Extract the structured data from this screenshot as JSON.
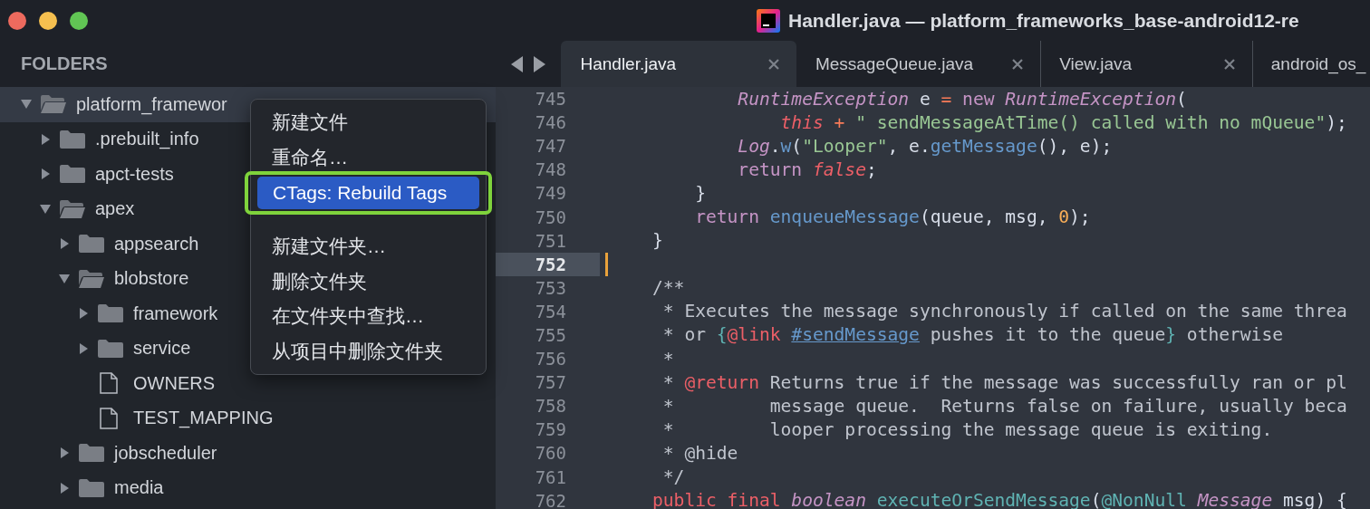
{
  "window": {
    "title": "Handler.java — platform_frameworks_base-android12-re"
  },
  "sidebar": {
    "heading": "FOLDERS",
    "tree": [
      {
        "label": "platform_framewor",
        "kind": "folder",
        "expanded": true,
        "selected": true,
        "children": [
          {
            "label": ".prebuilt_info",
            "kind": "folder",
            "expanded": false,
            "selected": false
          },
          {
            "label": "apct-tests",
            "kind": "folder",
            "expanded": false,
            "selected": false
          },
          {
            "label": "apex",
            "kind": "folder",
            "expanded": true,
            "selected": false,
            "children": [
              {
                "label": "appsearch",
                "kind": "folder",
                "expanded": false,
                "selected": false
              },
              {
                "label": "blobstore",
                "kind": "folder",
                "expanded": true,
                "selected": false,
                "children": [
                  {
                    "label": "framework",
                    "kind": "folder",
                    "expanded": false,
                    "selected": false
                  },
                  {
                    "label": "service",
                    "kind": "folder",
                    "expanded": false,
                    "selected": false
                  },
                  {
                    "label": "OWNERS",
                    "kind": "file",
                    "selected": false
                  },
                  {
                    "label": "TEST_MAPPING",
                    "kind": "file",
                    "selected": false
                  }
                ]
              },
              {
                "label": "jobscheduler",
                "kind": "folder",
                "expanded": false,
                "selected": false
              },
              {
                "label": "media",
                "kind": "folder",
                "expanded": false,
                "selected": false
              }
            ]
          }
        ]
      }
    ]
  },
  "context_menu": {
    "items": [
      {
        "kind": "item",
        "label": "新建文件",
        "selected": false,
        "outlined": false
      },
      {
        "kind": "item",
        "label": "重命名…",
        "selected": false,
        "outlined": false
      },
      {
        "kind": "item",
        "label": "CTags: Rebuild Tags",
        "selected": true,
        "outlined": true
      },
      {
        "kind": "separator"
      },
      {
        "kind": "item",
        "label": "新建文件夹…",
        "selected": false,
        "outlined": false
      },
      {
        "kind": "item",
        "label": "删除文件夹",
        "selected": false,
        "outlined": false
      },
      {
        "kind": "item",
        "label": "在文件夹中查找…",
        "selected": false,
        "outlined": false
      },
      {
        "kind": "item",
        "label": "从项目中删除文件夹",
        "selected": false,
        "outlined": false
      }
    ]
  },
  "tabs": [
    {
      "label": "Handler.java",
      "selected": true,
      "closable": true
    },
    {
      "label": "MessageQueue.java",
      "selected": false,
      "closable": true
    },
    {
      "label": "View.java",
      "selected": false,
      "closable": true
    },
    {
      "label": "android_os_",
      "selected": false,
      "closable": false
    }
  ],
  "editor": {
    "lines": [
      {
        "number": "745",
        "current": false,
        "tokens": [
          {
            "kind": "type",
            "t": "        RuntimeException"
          },
          {
            "kind": "plain",
            "t": " e "
          },
          {
            "kind": "op",
            "t": "= "
          },
          {
            "kind": "kw",
            "t": "new "
          },
          {
            "kind": "type",
            "t": "RuntimeException"
          },
          {
            "kind": "plain",
            "t": "("
          }
        ]
      },
      {
        "number": "746",
        "current": false,
        "tokens": [
          {
            "kind": "lit",
            "t": "            this "
          },
          {
            "kind": "op",
            "t": "+ "
          },
          {
            "kind": "str",
            "t": "\" sendMessageAtTime() called with no mQueue\""
          },
          {
            "kind": "plain",
            "t": ");"
          }
        ]
      },
      {
        "number": "747",
        "current": false,
        "tokens": [
          {
            "kind": "type",
            "t": "        Log"
          },
          {
            "kind": "plain",
            "t": "."
          },
          {
            "kind": "fn",
            "t": "w"
          },
          {
            "kind": "plain",
            "t": "("
          },
          {
            "kind": "str",
            "t": "\"Looper\""
          },
          {
            "kind": "plain",
            "t": ", e."
          },
          {
            "kind": "fn",
            "t": "getMessage"
          },
          {
            "kind": "plain",
            "t": "(), e);"
          }
        ]
      },
      {
        "number": "748",
        "current": false,
        "tokens": [
          {
            "kind": "kw",
            "t": "        return "
          },
          {
            "kind": "lit",
            "t": "false"
          },
          {
            "kind": "plain",
            "t": ";"
          }
        ]
      },
      {
        "number": "749",
        "current": false,
        "tokens": [
          {
            "kind": "plain",
            "t": "    }"
          }
        ]
      },
      {
        "number": "750",
        "current": false,
        "tokens": [
          {
            "kind": "kw",
            "t": "    return "
          },
          {
            "kind": "fn",
            "t": "enqueueMessage"
          },
          {
            "kind": "plain",
            "t": "(queue, msg, "
          },
          {
            "kind": "num",
            "t": "0"
          },
          {
            "kind": "plain",
            "t": ");"
          }
        ]
      },
      {
        "number": "751",
        "current": false,
        "tokens": [
          {
            "kind": "plain",
            "t": "}"
          }
        ]
      },
      {
        "number": "752",
        "current": true
      },
      {
        "number": "753",
        "current": false,
        "tokens": [
          {
            "kind": "cm",
            "t": "/**"
          }
        ]
      },
      {
        "number": "754",
        "current": false,
        "tokens": [
          {
            "kind": "cm",
            "t": " * Executes the message synchronously if called on the same threa"
          }
        ]
      },
      {
        "number": "755",
        "current": false,
        "tokens": [
          {
            "kind": "cm",
            "t": " * or "
          },
          {
            "kind": "brace",
            "t": "{"
          },
          {
            "kind": "tag",
            "t": "@link "
          },
          {
            "kind": "link",
            "t": "#sendMessage"
          },
          {
            "kind": "cm",
            "t": " pushes it to the queue"
          },
          {
            "kind": "brace",
            "t": "}"
          },
          {
            "kind": "cm",
            "t": " otherwise"
          }
        ]
      },
      {
        "number": "756",
        "current": false,
        "tokens": [
          {
            "kind": "cm",
            "t": " *"
          }
        ]
      },
      {
        "number": "757",
        "current": false,
        "tokens": [
          {
            "kind": "cm",
            "t": " * "
          },
          {
            "kind": "tag",
            "t": "@return"
          },
          {
            "kind": "cm",
            "t": " Returns true if the message was successfully ran or pl"
          }
        ]
      },
      {
        "number": "758",
        "current": false,
        "tokens": [
          {
            "kind": "cm",
            "t": " *         message queue.  Returns false on failure, usually beca"
          }
        ]
      },
      {
        "number": "759",
        "current": false,
        "tokens": [
          {
            "kind": "cm",
            "t": " *         looper processing the message queue is exiting."
          }
        ]
      },
      {
        "number": "760",
        "current": false,
        "tokens": [
          {
            "kind": "cm",
            "t": " * @hide"
          }
        ]
      },
      {
        "number": "761",
        "current": false,
        "tokens": [
          {
            "kind": "cm",
            "t": " */"
          }
        ]
      },
      {
        "number": "762",
        "current": false,
        "tokens": [
          {
            "kind": "mod",
            "t": "public final "
          },
          {
            "kind": "type",
            "t": "boolean "
          },
          {
            "kind": "decl",
            "t": "executeOrSendMessage"
          },
          {
            "kind": "plain",
            "t": "("
          },
          {
            "kind": "ann",
            "t": "@NonNull "
          },
          {
            "kind": "type",
            "t": "Message"
          },
          {
            "kind": "plain",
            "t": " msg) {"
          }
        ]
      }
    ]
  }
}
